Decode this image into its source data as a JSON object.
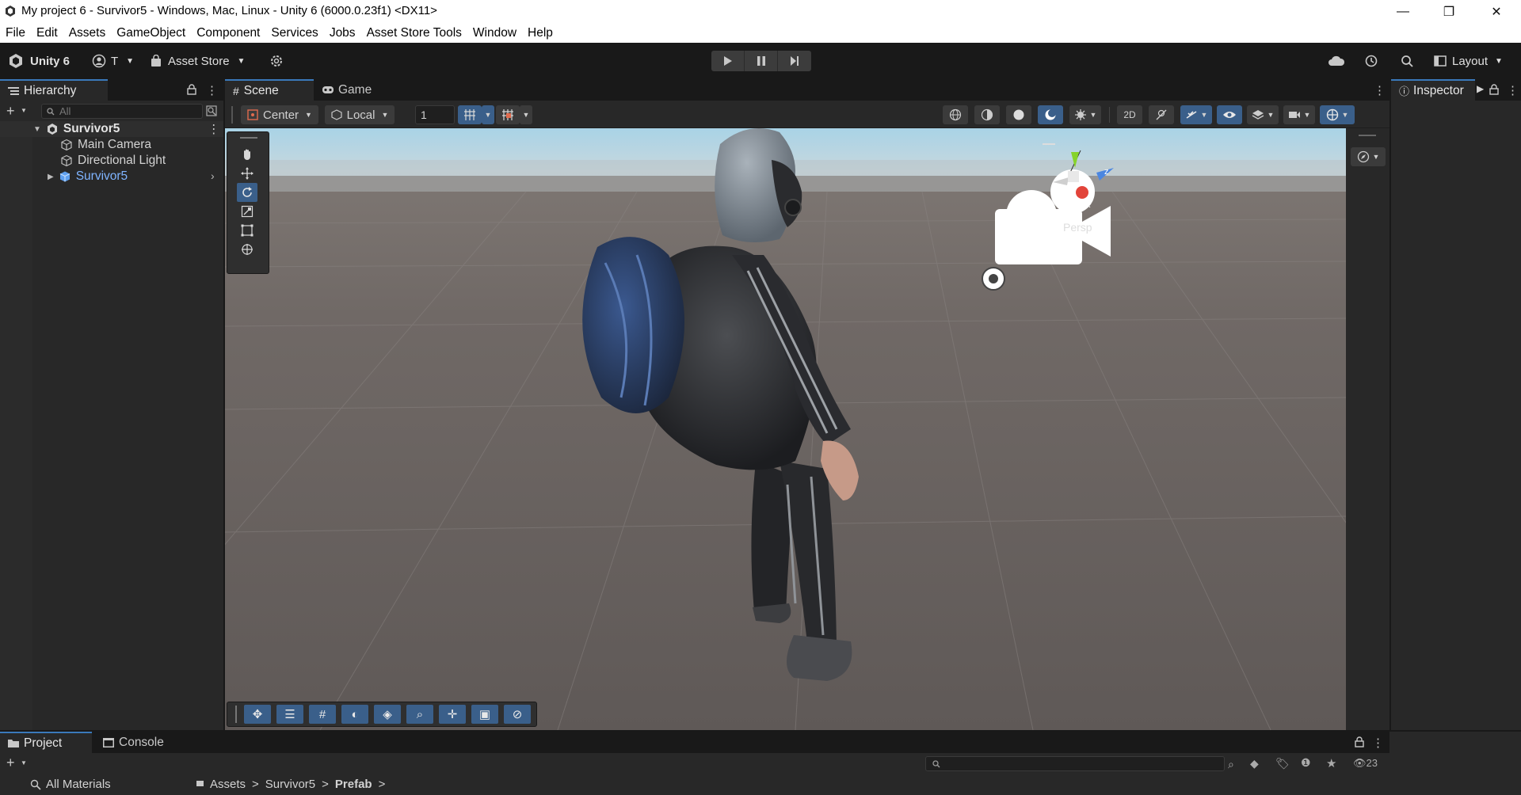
{
  "window": {
    "title": "My project 6 - Survivor5 - Windows, Mac, Linux - Unity 6 (6000.0.23f1) <DX11>",
    "minimize": "—",
    "maximize": "❐",
    "close": "✕"
  },
  "menu": [
    "File",
    "Edit",
    "Assets",
    "GameObject",
    "Component",
    "Services",
    "Jobs",
    "Asset Store Tools",
    "Window",
    "Help"
  ],
  "toolbar": {
    "unity_label": "Unity 6",
    "account_label": "T",
    "asset_store_label": "Asset Store",
    "layout_label": "Layout"
  },
  "hierarchy": {
    "tab_label": "Hierarchy",
    "search_placeholder": "All",
    "items": [
      {
        "label": "Survivor5",
        "icon": "scene-icon"
      },
      {
        "label": "Main Camera",
        "icon": "gameobject-icon"
      },
      {
        "label": "Directional Light",
        "icon": "gameobject-icon"
      },
      {
        "label": "Survivor5",
        "icon": "prefab-icon"
      }
    ]
  },
  "scene": {
    "tabs": [
      "Scene",
      "Game"
    ],
    "pivot_label": "Center",
    "space_label": "Local",
    "grid_snap_value": "1",
    "gizmo_projection": "Persp",
    "axes": {
      "x": "x",
      "z": "z"
    }
  },
  "inspector": {
    "tab_label": "Inspector"
  },
  "bottom": {
    "tabs": [
      "Project",
      "Console"
    ],
    "search_item": "All Materials",
    "breadcrumb": [
      "Assets",
      "Survivor5",
      "Prefab"
    ],
    "count": "23"
  },
  "colors": {
    "accent": "#3a79bb",
    "prefab_blue": "#7fb4ff",
    "panel": "#282828",
    "toolbar": "#191919"
  }
}
